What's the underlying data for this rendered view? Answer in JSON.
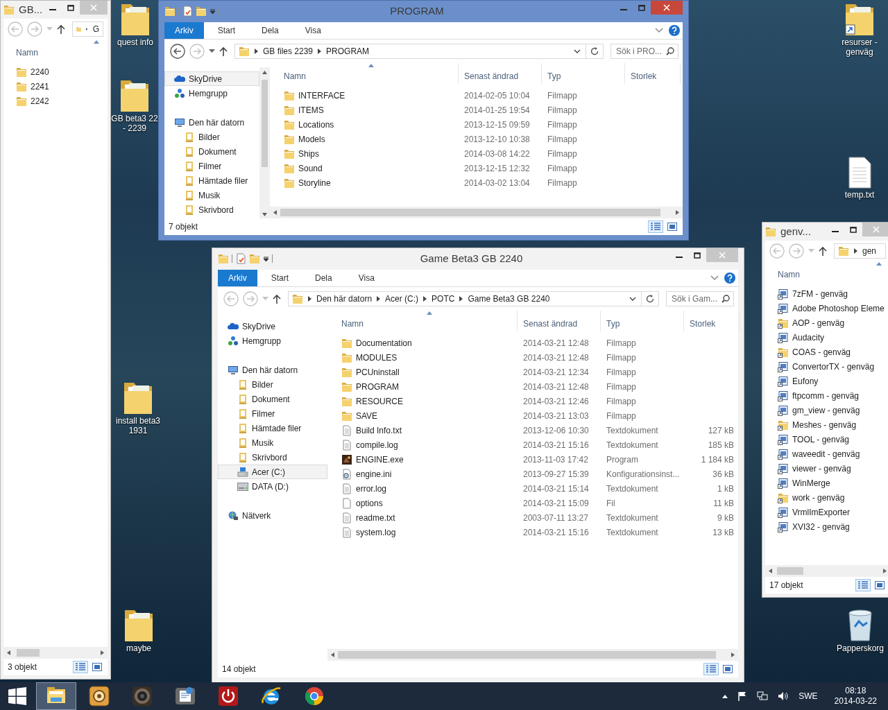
{
  "desktop_icons": [
    {
      "label": "quest info",
      "kind": "folder"
    },
    {
      "label": "GB beta3 22\n- 2239",
      "kind": "folder"
    },
    {
      "label": "install beta3\n1931",
      "kind": "folder"
    },
    {
      "label": "maybe",
      "kind": "folder"
    },
    {
      "label": "resurser -\ngenväg",
      "kind": "folder_link"
    },
    {
      "label": "temp.txt",
      "kind": "text"
    },
    {
      "label": "Papperskorg",
      "kind": "bin"
    }
  ],
  "windows": [
    {
      "title": "GB...",
      "active": false,
      "address": [
        "G"
      ],
      "columns": [
        {
          "label": "Namn",
          "sorted": true
        }
      ],
      "rows": [
        {
          "kind": "folder",
          "cells": [
            "2240"
          ]
        },
        {
          "kind": "folder",
          "cells": [
            "2241"
          ]
        },
        {
          "kind": "folder",
          "cells": [
            "2242"
          ]
        }
      ],
      "status": "3 objekt"
    },
    {
      "title": "PROGRAM",
      "active": true,
      "ribbon_tabs": [
        {
          "label": "Arkiv",
          "kind": "file"
        },
        {
          "label": "Start",
          "kind": "tab"
        },
        {
          "label": "Dela",
          "kind": "tab"
        },
        {
          "label": "Visa",
          "kind": "tab"
        }
      ],
      "address": [
        "GB files 2239",
        "PROGRAM"
      ],
      "search": {
        "placeholder": "Sök i PRO..."
      },
      "nav": [
        {
          "label": "SkyDrive",
          "kind": "cloud",
          "selected": true
        },
        {
          "label": "Hemgrupp",
          "kind": "homegroup",
          "selected": false
        },
        {
          "label": "Den här datorn",
          "kind": "computer",
          "selected": false,
          "children": [
            {
              "label": "Bilder",
              "kind": "library",
              "selected": false
            },
            {
              "label": "Dokument",
              "kind": "library",
              "selected": false
            },
            {
              "label": "Filmer",
              "kind": "library",
              "selected": false
            },
            {
              "label": "Hämtade filer",
              "kind": "library",
              "selected": false
            },
            {
              "label": "Musik",
              "kind": "library",
              "selected": false
            },
            {
              "label": "Skrivbord",
              "kind": "library",
              "selected": false
            }
          ]
        }
      ],
      "columns": [
        {
          "label": "Namn",
          "sorted": true
        },
        {
          "label": "Senast ändrad",
          "sorted": false
        },
        {
          "label": "Typ",
          "sorted": false
        },
        {
          "label": "Storlek",
          "sorted": false
        }
      ],
      "rows": [
        {
          "kind": "folder",
          "cells": [
            "INTERFACE",
            "2014-02-05 10:04",
            "Filmapp"
          ]
        },
        {
          "kind": "folder",
          "cells": [
            "ITEMS",
            "2014-01-25 19:54",
            "Filmapp"
          ]
        },
        {
          "kind": "folder",
          "cells": [
            "Locations",
            "2013-12-15 09:59",
            "Filmapp"
          ]
        },
        {
          "kind": "folder",
          "cells": [
            "Models",
            "2013-12-10 10:38",
            "Filmapp"
          ]
        },
        {
          "kind": "folder",
          "cells": [
            "Ships",
            "2014-03-08 14:22",
            "Filmapp"
          ]
        },
        {
          "kind": "folder",
          "cells": [
            "Sound",
            "2013-12-15 12:32",
            "Filmapp"
          ]
        },
        {
          "kind": "folder",
          "cells": [
            "Storyline",
            "2014-03-02 13:04",
            "Filmapp"
          ]
        }
      ],
      "status": "7 objekt"
    },
    {
      "title": "Game Beta3 GB 2240",
      "active": false,
      "ribbon_tabs": [
        {
          "label": "Arkiv",
          "kind": "file"
        },
        {
          "label": "Start",
          "kind": "tab"
        },
        {
          "label": "Dela",
          "kind": "tab"
        },
        {
          "label": "Visa",
          "kind": "tab"
        }
      ],
      "address": [
        "Den här datorn",
        "Acer (C:)",
        "POTC",
        "Game Beta3 GB 2240"
      ],
      "search": {
        "placeholder": "Sök i Gam..."
      },
      "nav": [
        {
          "label": "SkyDrive",
          "kind": "cloud",
          "selected": false
        },
        {
          "label": "Hemgrupp",
          "kind": "homegroup",
          "selected": false
        },
        {
          "label": "Den här datorn",
          "kind": "computer",
          "selected": false,
          "children": [
            {
              "label": "Bilder",
              "kind": "library",
              "selected": false
            },
            {
              "label": "Dokument",
              "kind": "library",
              "selected": false
            },
            {
              "label": "Filmer",
              "kind": "library",
              "selected": false
            },
            {
              "label": "Hämtade filer",
              "kind": "library",
              "selected": false
            },
            {
              "label": "Musik",
              "kind": "library",
              "selected": false
            },
            {
              "label": "Skrivbord",
              "kind": "library",
              "selected": false
            },
            {
              "label": "Acer (C:)",
              "kind": "system_drive",
              "selected": true
            },
            {
              "label": "DATA (D:)",
              "kind": "drive",
              "selected": false
            }
          ]
        },
        {
          "label": "Nätverk",
          "kind": "network",
          "selected": false
        }
      ],
      "columns": [
        {
          "label": "Namn",
          "sorted": true
        },
        {
          "label": "Senast ändrad",
          "sorted": false
        },
        {
          "label": "Typ",
          "sorted": false
        },
        {
          "label": "Storlek",
          "sorted": false
        }
      ],
      "rows": [
        {
          "kind": "folder",
          "cells": [
            "Documentation",
            "2014-03-21 12:48",
            "Filmapp"
          ]
        },
        {
          "kind": "folder",
          "cells": [
            "MODULES",
            "2014-03-21 12:48",
            "Filmapp"
          ]
        },
        {
          "kind": "folder",
          "cells": [
            "PCUninstall",
            "2014-03-21 12:34",
            "Filmapp"
          ]
        },
        {
          "kind": "folder",
          "cells": [
            "PROGRAM",
            "2014-03-21 12:48",
            "Filmapp"
          ]
        },
        {
          "kind": "folder",
          "cells": [
            "RESOURCE",
            "2014-03-21 12:46",
            "Filmapp"
          ]
        },
        {
          "kind": "folder",
          "cells": [
            "SAVE",
            "2014-03-21 13:03",
            "Filmapp"
          ]
        },
        {
          "kind": "text",
          "cells": [
            "Build Info.txt",
            "2013-12-06 10:30",
            "Textdokument",
            "127 kB"
          ]
        },
        {
          "kind": "text",
          "cells": [
            "compile.log",
            "2014-03-21 15:16",
            "Textdokument",
            "185 kB"
          ]
        },
        {
          "kind": "exe",
          "cells": [
            "ENGINE.exe",
            "2013-11-03 17:42",
            "Program",
            "1 184 kB"
          ]
        },
        {
          "kind": "ini",
          "cells": [
            "engine.ini",
            "2013-09-27 15:39",
            "Konfigurationsinst...",
            "36 kB"
          ]
        },
        {
          "kind": "text",
          "cells": [
            "error.log",
            "2014-03-21 15:14",
            "Textdokument",
            "1 kB"
          ]
        },
        {
          "kind": "file",
          "cells": [
            "options",
            "2014-03-21 15:09",
            "Fil",
            "11 kB"
          ]
        },
        {
          "kind": "text",
          "cells": [
            "readme.txt",
            "2003-07-11 13:27",
            "Textdokument",
            "9 kB"
          ]
        },
        {
          "kind": "text",
          "cells": [
            "system.log",
            "2014-03-21 15:16",
            "Textdokument",
            "13 kB"
          ]
        }
      ],
      "status": "14 objekt"
    },
    {
      "title": "genv...",
      "active": false,
      "address": [
        "gen"
      ],
      "columns": [
        {
          "label": "Namn",
          "sorted": true
        }
      ],
      "rows": [
        {
          "kind": "app",
          "cells": [
            "7zFM - genväg"
          ]
        },
        {
          "kind": "app",
          "cells": [
            "Adobe Photoshop Eleme"
          ]
        },
        {
          "kind": "folder_link",
          "cells": [
            "AOP - genväg"
          ]
        },
        {
          "kind": "app",
          "cells": [
            "Audacity"
          ]
        },
        {
          "kind": "folder_link",
          "cells": [
            "COAS - genväg"
          ]
        },
        {
          "kind": "app",
          "cells": [
            "ConvertorTX - genväg"
          ]
        },
        {
          "kind": "app",
          "cells": [
            "Eufony"
          ]
        },
        {
          "kind": "app",
          "cells": [
            "ftpcomm - genväg"
          ]
        },
        {
          "kind": "app",
          "cells": [
            "gm_view - genväg"
          ]
        },
        {
          "kind": "folder_link",
          "cells": [
            "Meshes - genväg"
          ]
        },
        {
          "kind": "app",
          "cells": [
            "TOOL - genväg"
          ]
        },
        {
          "kind": "app",
          "cells": [
            "waveedit - genväg"
          ]
        },
        {
          "kind": "app",
          "cells": [
            "viewer - genväg"
          ]
        },
        {
          "kind": "app",
          "cells": [
            "WinMerge"
          ]
        },
        {
          "kind": "folder_link",
          "cells": [
            "work - genväg"
          ]
        },
        {
          "kind": "app",
          "cells": [
            "VrmlImExporter"
          ]
        },
        {
          "kind": "app",
          "cells": [
            "XVI32 - genväg"
          ]
        }
      ],
      "status": "17 objekt"
    }
  ],
  "taskbar": {
    "items": [
      {
        "kind": "explorer",
        "selected": true
      },
      {
        "kind": "gold_app",
        "selected": false
      },
      {
        "kind": "speaker_app",
        "selected": false
      },
      {
        "kind": "doc_app",
        "selected": false
      },
      {
        "kind": "power_app",
        "selected": false
      },
      {
        "kind": "ie",
        "selected": false
      },
      {
        "kind": "chrome",
        "selected": false
      }
    ],
    "language": "SWE",
    "time": "08:18",
    "date": "2014-03-22"
  }
}
